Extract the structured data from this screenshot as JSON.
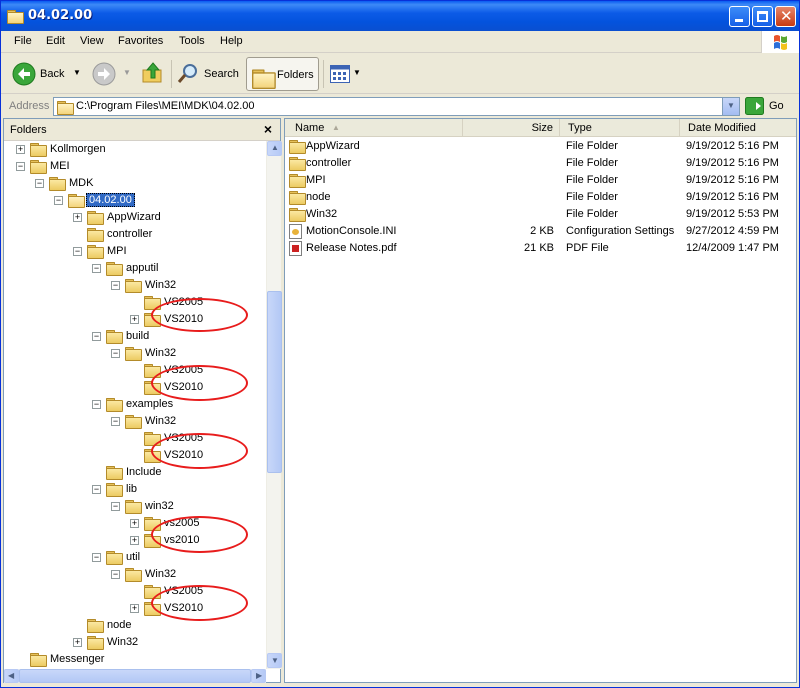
{
  "window": {
    "title": "04.02.00"
  },
  "menu": [
    "File",
    "Edit",
    "View",
    "Favorites",
    "Tools",
    "Help"
  ],
  "toolbar": {
    "back_label": "Back",
    "search_label": "Search",
    "folders_label": "Folders"
  },
  "address": {
    "label": "Address",
    "value": "C:\\Program Files\\MEI\\MDK\\04.02.00",
    "go_label": "Go"
  },
  "folders_pane": {
    "title": "Folders",
    "close_label": "×",
    "tree": [
      {
        "label": "Kollmorgen",
        "level": 0,
        "expander": "+"
      },
      {
        "label": "MEI",
        "level": 0,
        "expander": "−"
      },
      {
        "label": "MDK",
        "level": 1,
        "expander": "−"
      },
      {
        "label": "04.02.00",
        "level": 2,
        "expander": "−",
        "selected": true,
        "open": true
      },
      {
        "label": "AppWizard",
        "level": 3,
        "expander": "+"
      },
      {
        "label": "controller",
        "level": 3,
        "expander": ""
      },
      {
        "label": "MPI",
        "level": 3,
        "expander": "−"
      },
      {
        "label": "apputil",
        "level": 4,
        "expander": "−"
      },
      {
        "label": "Win32",
        "level": 5,
        "expander": "−"
      },
      {
        "label": "VS2005",
        "level": 6,
        "expander": ""
      },
      {
        "label": "VS2010",
        "level": 6,
        "expander": "+"
      },
      {
        "label": "build",
        "level": 4,
        "expander": "−"
      },
      {
        "label": "Win32",
        "level": 5,
        "expander": "−"
      },
      {
        "label": "VS2005",
        "level": 6,
        "expander": ""
      },
      {
        "label": "VS2010",
        "level": 6,
        "expander": ""
      },
      {
        "label": "examples",
        "level": 4,
        "expander": "−"
      },
      {
        "label": "Win32",
        "level": 5,
        "expander": "−"
      },
      {
        "label": "VS2005",
        "level": 6,
        "expander": ""
      },
      {
        "label": "VS2010",
        "level": 6,
        "expander": ""
      },
      {
        "label": "Include",
        "level": 4,
        "expander": ""
      },
      {
        "label": "lib",
        "level": 4,
        "expander": "−"
      },
      {
        "label": "win32",
        "level": 5,
        "expander": "−"
      },
      {
        "label": "vs2005",
        "level": 6,
        "expander": "+"
      },
      {
        "label": "vs2010",
        "level": 6,
        "expander": "+"
      },
      {
        "label": "util",
        "level": 4,
        "expander": "−"
      },
      {
        "label": "Win32",
        "level": 5,
        "expander": "−"
      },
      {
        "label": "VS2005",
        "level": 6,
        "expander": ""
      },
      {
        "label": "VS2010",
        "level": 6,
        "expander": "+"
      },
      {
        "label": "node",
        "level": 3,
        "expander": ""
      },
      {
        "label": "Win32",
        "level": 3,
        "expander": "+"
      },
      {
        "label": "Messenger",
        "level": 0,
        "expander": ""
      }
    ]
  },
  "file_list": {
    "columns": [
      "Name",
      "Size",
      "Type",
      "Date Modified"
    ],
    "rows": [
      {
        "name": "AppWizard",
        "size": "",
        "type": "File Folder",
        "date": "9/19/2012 5:16 PM",
        "icon": "folder-icon"
      },
      {
        "name": "controller",
        "size": "",
        "type": "File Folder",
        "date": "9/19/2012 5:16 PM",
        "icon": "folder-icon"
      },
      {
        "name": "MPI",
        "size": "",
        "type": "File Folder",
        "date": "9/19/2012 5:16 PM",
        "icon": "folder-icon"
      },
      {
        "name": "node",
        "size": "",
        "type": "File Folder",
        "date": "9/19/2012 5:16 PM",
        "icon": "folder-icon"
      },
      {
        "name": "Win32",
        "size": "",
        "type": "File Folder",
        "date": "9/19/2012 5:53 PM",
        "icon": "folder-icon"
      },
      {
        "name": "MotionConsole.INI",
        "size": "2 KB",
        "type": "Configuration Settings",
        "date": "9/27/2012 4:59 PM",
        "icon": "ini-file-icon"
      },
      {
        "name": "Release Notes.pdf",
        "size": "21 KB",
        "type": "PDF File",
        "date": "12/4/2009 1:47 PM",
        "icon": "pdf-file-icon"
      }
    ]
  },
  "colors": {
    "titlebar": "#0a5cf1",
    "selection": "#316ac5",
    "annotation": "#e81c1c"
  }
}
